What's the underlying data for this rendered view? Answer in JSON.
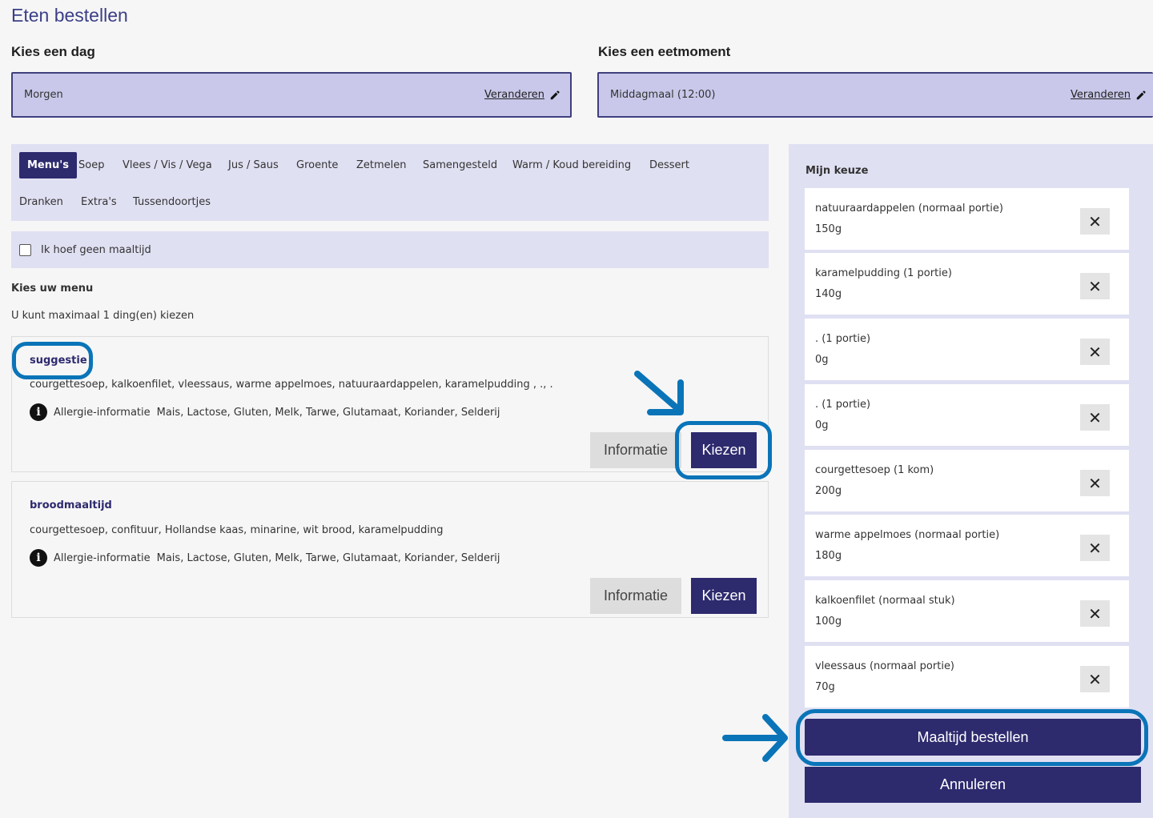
{
  "page_title": "Eten bestellen",
  "day": {
    "label": "Kies een dag",
    "value": "Morgen",
    "change_label": "Veranderen"
  },
  "moment": {
    "label": "Kies een eetmoment",
    "value": "Middagmaal (12:00)",
    "change_label": "Veranderen"
  },
  "categories": [
    {
      "label": "Menu's",
      "active": true
    },
    {
      "label": "Soep"
    },
    {
      "label": "Vlees / Vis / Vega"
    },
    {
      "label": "Jus / Saus"
    },
    {
      "label": "Groente"
    },
    {
      "label": "Zetmelen"
    },
    {
      "label": "Samengesteld"
    },
    {
      "label": "Warm / Koud bereiding"
    },
    {
      "label": "Dessert"
    },
    {
      "label": "Dranken"
    },
    {
      "label": "Extra's"
    },
    {
      "label": "Tussendoortjes"
    }
  ],
  "no_meal_label": "Ik hoef geen maaltijd",
  "menu_section": {
    "title": "Kies uw menu",
    "limit_text": "U kunt maximaal 1 ding(en) kiezen"
  },
  "menus": [
    {
      "title": "suggestie",
      "description": "courgettesoep, kalkoenfilet, vleessaus, warme appelmoes, natuuraardappelen, karamelpudding , ., .",
      "allergy_label": "Allergie-informatie",
      "allergens": "Mais, Lactose, Gluten, Melk, Tarwe, Glutamaat, Koriander, Selderij",
      "info_button": "Informatie",
      "choose_button": "Kiezen"
    },
    {
      "title": "broodmaaltijd",
      "description": "courgettesoep, confituur, Hollandse kaas, minarine, wit brood, karamelpudding",
      "allergy_label": "Allergie-informatie",
      "allergens": "Mais, Lactose, Gluten, Melk, Tarwe, Glutamaat, Koriander, Selderij",
      "info_button": "Informatie",
      "choose_button": "Kiezen"
    }
  ],
  "my_choice": {
    "title": "Mijn keuze",
    "items": [
      {
        "name": "natuuraardappelen (normaal portie)",
        "qty": "150g"
      },
      {
        "name": "karamelpudding (1 portie)",
        "qty": "140g"
      },
      {
        "name": ". (1 portie)",
        "qty": "0g"
      },
      {
        "name": ". (1 portie)",
        "qty": "0g"
      },
      {
        "name": "courgettesoep (1 kom)",
        "qty": "200g"
      },
      {
        "name": "warme appelmoes (normaal portie)",
        "qty": "180g"
      },
      {
        "name": "kalkoenfilet (normaal stuk)",
        "qty": "100g"
      },
      {
        "name": "vleessaus (normaal portie)",
        "qty": "70g"
      }
    ],
    "order_button": "Maaltijd bestellen",
    "cancel_button": "Annuleren"
  },
  "colors": {
    "primary": "#2d2a6e",
    "panel": "#e0e0f3",
    "picker": "#c9c8ea",
    "highlight": "#0a74b8"
  },
  "icons": {
    "edit": "pencil-icon",
    "remove": "close-icon",
    "info": "info-icon",
    "annotation": "arrow-icon"
  }
}
